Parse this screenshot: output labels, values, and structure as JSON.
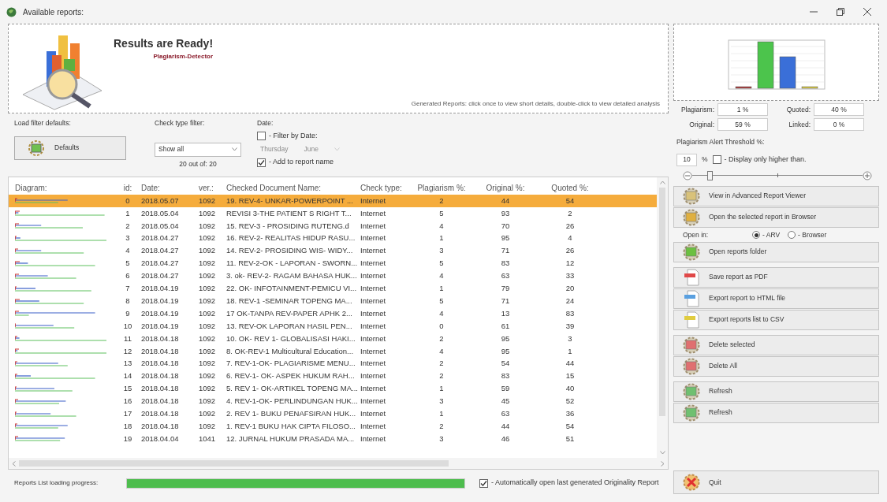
{
  "window": {
    "title": "Available reports:"
  },
  "banner": {
    "title": "Results are Ready!",
    "subtitle": "Plagiarism-Detector",
    "hint": "Generated Reports: click once to view short details, double-click to view detailed analysis"
  },
  "summary": {
    "stats": [
      {
        "label": "Plagiarism:",
        "value": "1 %"
      },
      {
        "label": "Quoted:",
        "value": "40 %"
      },
      {
        "label": "Original:",
        "value": "59 %"
      },
      {
        "label": "Linked:",
        "value": "0 %"
      }
    ],
    "threshold_label": "Plagiarism Alert Threshold %:",
    "threshold_value": "10",
    "threshold_unit": "%",
    "display_only_higher": {
      "label": "- Display only higher than.",
      "checked": false
    },
    "slider": {
      "level": 0.1
    }
  },
  "filters": {
    "defaults_label": "Load filter defaults:",
    "defaults_button": "Defaults",
    "check_type_label": "Check type filter:",
    "check_type_value": "Show all",
    "count": "20 out of: 20",
    "date_label": "Date:",
    "filter_by_date": {
      "label": "- Filter by Date:",
      "checked": false
    },
    "day": "Thursday",
    "month": "June",
    "date_disabled": true,
    "add_to_name": {
      "label": "- Add to report name",
      "checked": true
    }
  },
  "table": {
    "columns": [
      "Diagram:",
      "id:",
      "Date:",
      "ver.:",
      "Checked Document Name:",
      "Check type:",
      "Plagiarism %:",
      "Original %:",
      "Quoted %:"
    ],
    "rows": [
      {
        "id": "0",
        "date": "2018.05.07",
        "ver": "1092",
        "name": "19. REV-4- UNKAR-POWERPOINT ...",
        "check_type": "Internet",
        "plagiarism": "2",
        "original": "44",
        "quoted": "54",
        "selected": true
      },
      {
        "id": "1",
        "date": "2018.05.04",
        "ver": "1092",
        "name": "REVISI 3-THE PATIENT S RIGHT T...",
        "check_type": "Internet",
        "plagiarism": "5",
        "original": "93",
        "quoted": "2",
        "selected": false
      },
      {
        "id": "2",
        "date": "2018.05.04",
        "ver": "1092",
        "name": "15. REV-3 - PROSIDING RUTENG.d",
        "check_type": "Internet",
        "plagiarism": "4",
        "original": "70",
        "quoted": "26",
        "selected": false
      },
      {
        "id": "3",
        "date": "2018.04.27",
        "ver": "1092",
        "name": "16. REV-2- REALITAS HIDUP RASU...",
        "check_type": "Internet",
        "plagiarism": "1",
        "original": "95",
        "quoted": "4",
        "selected": false
      },
      {
        "id": "4",
        "date": "2018.04.27",
        "ver": "1092",
        "name": "14. REV-2- PROSIDING WIS- WIDY...",
        "check_type": "Internet",
        "plagiarism": "3",
        "original": "71",
        "quoted": "26",
        "selected": false
      },
      {
        "id": "5",
        "date": "2018.04.27",
        "ver": "1092",
        "name": "11. REV-2-OK - LAPORAN - SWORN...",
        "check_type": "Internet",
        "plagiarism": "5",
        "original": "83",
        "quoted": "12",
        "selected": false
      },
      {
        "id": "6",
        "date": "2018.04.27",
        "ver": "1092",
        "name": "3. ok- REV-2- RAGAM BAHASA HUK...",
        "check_type": "Internet",
        "plagiarism": "4",
        "original": "63",
        "quoted": "33",
        "selected": false
      },
      {
        "id": "7",
        "date": "2018.04.19",
        "ver": "1092",
        "name": "22. OK- INFOTAINMENT-PEMICU VI...",
        "check_type": "Internet",
        "plagiarism": "1",
        "original": "79",
        "quoted": "20",
        "selected": false
      },
      {
        "id": "8",
        "date": "2018.04.19",
        "ver": "1092",
        "name": "18. REV-1 -SEMINAR TOPENG MA...",
        "check_type": "Internet",
        "plagiarism": "5",
        "original": "71",
        "quoted": "24",
        "selected": false
      },
      {
        "id": "9",
        "date": "2018.04.19",
        "ver": "1092",
        "name": "17 OK-TANPA REV-PAPER APHK 2...",
        "check_type": "Internet",
        "plagiarism": "4",
        "original": "13",
        "quoted": "83",
        "selected": false
      },
      {
        "id": "10",
        "date": "2018.04.19",
        "ver": "1092",
        "name": "13. REV-OK LAPORAN HASIL PEN...",
        "check_type": "Internet",
        "plagiarism": "0",
        "original": "61",
        "quoted": "39",
        "selected": false
      },
      {
        "id": "11",
        "date": "2018.04.18",
        "ver": "1092",
        "name": "10. OK- REV 1- GLOBALISASI HAKI...",
        "check_type": "Internet",
        "plagiarism": "2",
        "original": "95",
        "quoted": "3",
        "selected": false
      },
      {
        "id": "12",
        "date": "2018.04.18",
        "ver": "1092",
        "name": "8. OK-REV-1 Multicultural Education...",
        "check_type": "Internet",
        "plagiarism": "4",
        "original": "95",
        "quoted": "1",
        "selected": false
      },
      {
        "id": "13",
        "date": "2018.04.18",
        "ver": "1092",
        "name": "7. REV-1-OK- PLAGIARISME MENU...",
        "check_type": "Internet",
        "plagiarism": "2",
        "original": "54",
        "quoted": "44",
        "selected": false
      },
      {
        "id": "14",
        "date": "2018.04.18",
        "ver": "1092",
        "name": "6. REV-1- OK- ASPEK HUKUM RAH...",
        "check_type": "Internet",
        "plagiarism": "2",
        "original": "83",
        "quoted": "15",
        "selected": false
      },
      {
        "id": "15",
        "date": "2018.04.18",
        "ver": "1092",
        "name": "5. REV 1- OK-ARTIKEL TOPENG MA...",
        "check_type": "Internet",
        "plagiarism": "1",
        "original": "59",
        "quoted": "40",
        "selected": false
      },
      {
        "id": "16",
        "date": "2018.04.18",
        "ver": "1092",
        "name": "4. REV-1-OK- PERLINDUNGAN HUK...",
        "check_type": "Internet",
        "plagiarism": "3",
        "original": "45",
        "quoted": "52",
        "selected": false
      },
      {
        "id": "17",
        "date": "2018.04.18",
        "ver": "1092",
        "name": "2. REV 1- BUKU PENAFSIRAN HUK...",
        "check_type": "Internet",
        "plagiarism": "1",
        "original": "63",
        "quoted": "36",
        "selected": false
      },
      {
        "id": "18",
        "date": "2018.04.18",
        "ver": "1092",
        "name": "1. REV-1 BUKU HAK CIPTA FILOSO...",
        "check_type": "Internet",
        "plagiarism": "2",
        "original": "44",
        "quoted": "54",
        "selected": false
      },
      {
        "id": "19",
        "date": "2018.04.04",
        "ver": "1041",
        "name": "12. JURNAL HUKUM PRASADA MA...",
        "check_type": "Internet",
        "plagiarism": "3",
        "original": "46",
        "quoted": "51",
        "selected": false
      }
    ]
  },
  "progress": {
    "label": "Reports List loading progress:",
    "level": 1
  },
  "auto_open": {
    "label": "- Automatically open last generated Originality Report",
    "checked": true
  },
  "actions": {
    "top": [
      {
        "label": "View in Advanced Report Viewer",
        "kind": "viewer"
      },
      {
        "label": "Open the selected report in Browser",
        "kind": "browser"
      }
    ],
    "open_in": {
      "label": "Open in:",
      "options": [
        {
          "label": "- ARV",
          "selected": true
        },
        {
          "label": "- Browser",
          "selected": false
        }
      ]
    },
    "groups": [
      [
        {
          "label": "Open reports folder",
          "kind": "folder"
        }
      ],
      [
        {
          "label": "Save report as PDF",
          "kind": "pdf"
        },
        {
          "label": "Export report to HTML file",
          "kind": "html"
        },
        {
          "label": "Export reports list to CSV",
          "kind": "csv"
        }
      ],
      [
        {
          "label": "Delete selected",
          "kind": "delete"
        },
        {
          "label": "Delete All",
          "kind": "delete"
        }
      ],
      [
        {
          "label": "Refresh",
          "kind": "refresh"
        },
        {
          "label": "Refresh",
          "kind": "refresh"
        }
      ]
    ],
    "quit": {
      "label": "Quit",
      "kind": "quit"
    }
  }
}
